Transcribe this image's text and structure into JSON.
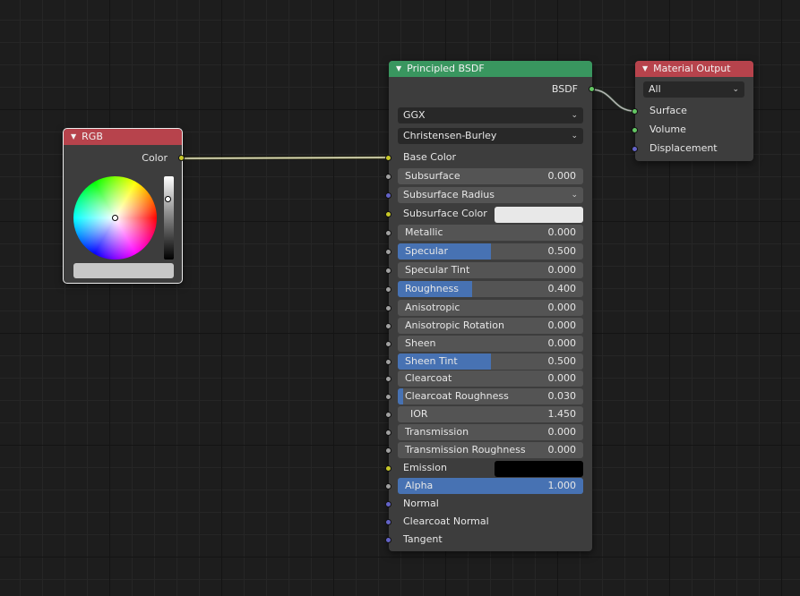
{
  "colors": {
    "socket_color": "#c7c729",
    "socket_float": "#a1a1a1",
    "socket_vector": "#6363c7",
    "socket_shader": "#63c763",
    "slider_fill": "#4772b3",
    "header_rgb": "#b7434c",
    "header_shader": "#39965f",
    "header_output": "#b7434c"
  },
  "rgb_node": {
    "title": "RGB",
    "output_label": "Color",
    "value_level": 0.75,
    "swatch_color": "#c7c7c7"
  },
  "bsdf_node": {
    "title": "Principled BSDF",
    "output_label": "BSDF",
    "distribution": "GGX",
    "subsurface_method": "Christensen-Burley",
    "base_color_label": "Base Color",
    "inputs": [
      {
        "label": "Subsurface",
        "value": "0.000",
        "fraction": 0
      },
      {
        "label": "Subsurface Radius",
        "dropdown": true
      },
      {
        "label": "Subsurface Color",
        "swatch": "#e8e8e8"
      },
      {
        "label": "Metallic",
        "value": "0.000",
        "fraction": 0
      },
      {
        "label": "Specular",
        "value": "0.500",
        "fraction": 0.5
      },
      {
        "label": "Specular Tint",
        "value": "0.000",
        "fraction": 0
      },
      {
        "label": "Roughness",
        "value": "0.400",
        "fraction": 0.4
      },
      {
        "label": "Anisotropic",
        "value": "0.000",
        "fraction": 0
      },
      {
        "label": "Anisotropic Rotation",
        "value": "0.000",
        "fraction": 0
      },
      {
        "label": "Sheen",
        "value": "0.000",
        "fraction": 0
      },
      {
        "label": "Sheen Tint",
        "value": "0.500",
        "fraction": 0.5
      },
      {
        "label": "Clearcoat",
        "value": "0.000",
        "fraction": 0
      },
      {
        "label": "Clearcoat Roughness",
        "value": "0.030",
        "fraction": 0.03
      },
      {
        "label": "IOR",
        "value": "1.450",
        "fraction": 0,
        "centered": true
      },
      {
        "label": "Transmission",
        "value": "0.000",
        "fraction": 0
      },
      {
        "label": "Transmission Roughness",
        "value": "0.000",
        "fraction": 0
      },
      {
        "label": "Emission",
        "swatch": "#000000"
      },
      {
        "label": "Alpha",
        "value": "1.000",
        "fraction": 1
      },
      {
        "label": "Normal",
        "plain": true
      },
      {
        "label": "Clearcoat Normal",
        "plain": true
      },
      {
        "label": "Tangent",
        "plain": true
      }
    ]
  },
  "output_node": {
    "title": "Material Output",
    "target": "All",
    "inputs": [
      "Surface",
      "Volume",
      "Displacement"
    ]
  }
}
